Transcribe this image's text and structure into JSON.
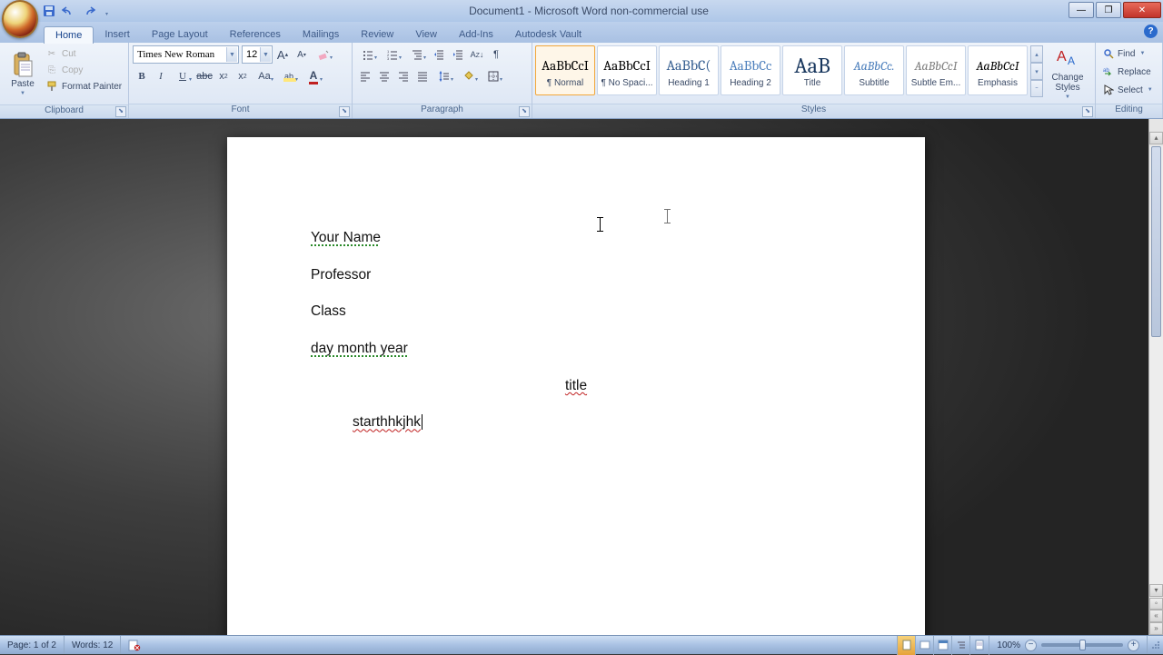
{
  "title": "Document1 - Microsoft Word non-commercial use",
  "qat": {
    "save": "save-icon",
    "undo": "undo-icon",
    "redo": "redo-icon"
  },
  "tabs": [
    "Home",
    "Insert",
    "Page Layout",
    "References",
    "Mailings",
    "Review",
    "View",
    "Add-Ins",
    "Autodesk Vault"
  ],
  "active_tab": "Home",
  "clipboard": {
    "label": "Clipboard",
    "paste": "Paste",
    "cut": "Cut",
    "copy": "Copy",
    "format_painter": "Format Painter"
  },
  "font": {
    "label": "Font",
    "name": "Times New Roman",
    "size": "12"
  },
  "paragraph": {
    "label": "Paragraph"
  },
  "styles": {
    "label": "Styles",
    "items": [
      {
        "sample": "AaBbCcI",
        "name": "¶ Normal",
        "color": "#000",
        "size": "15px"
      },
      {
        "sample": "AaBbCcI",
        "name": "¶ No Spaci...",
        "color": "#000",
        "size": "15px"
      },
      {
        "sample": "AaBbC(",
        "name": "Heading 1",
        "color": "#365f91",
        "size": "16px"
      },
      {
        "sample": "AaBbCc",
        "name": "Heading 2",
        "color": "#4f81bd",
        "size": "15px"
      },
      {
        "sample": "AaB",
        "name": "Title",
        "color": "#17365d",
        "size": "24px"
      },
      {
        "sample": "AaBbCc.",
        "name": "Subtitle",
        "color": "#4f81bd",
        "size": "14px",
        "italic": true
      },
      {
        "sample": "AaBbCcI",
        "name": "Subtle Em...",
        "color": "#808080",
        "size": "14px",
        "italic": true
      },
      {
        "sample": "AaBbCcI",
        "name": "Emphasis",
        "color": "#000",
        "size": "14px",
        "italic": true
      }
    ],
    "change_styles": "Change Styles"
  },
  "editing": {
    "label": "Editing",
    "find": "Find",
    "replace": "Replace",
    "select": "Select"
  },
  "document": {
    "lines": [
      "Your Name",
      "Professor",
      "Class",
      "day month year"
    ],
    "title_line": "title",
    "body_start": "starthhkjhk"
  },
  "status": {
    "page": "Page: 1 of 2",
    "words": "Words: 12",
    "zoom": "100%"
  }
}
